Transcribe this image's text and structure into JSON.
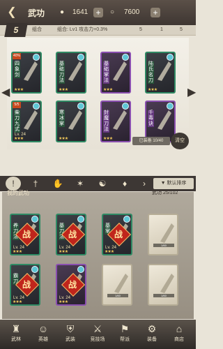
{
  "header": {
    "title": "武功",
    "gold": "1641",
    "silver": "7600",
    "back_icon": "arrow-left-icon",
    "add_label": "+"
  },
  "subbar": {
    "combo_badge": "5",
    "combo_tag": "组合",
    "bonus_text": "组合: Lv1 攻击力+0.3%",
    "stat_a": "5",
    "stat_b": "1",
    "stat_c": "5"
  },
  "equipped": [
    {
      "name": "四象剑",
      "tier": "40%",
      "level": "",
      "stars": "★★★",
      "type": "green"
    },
    {
      "name": "基础刀法",
      "tier": "",
      "level": "",
      "stars": "★★★",
      "type": "green"
    },
    {
      "name": "基础掌法",
      "tier": "",
      "level": "",
      "stars": "★★★",
      "type": "purple"
    },
    {
      "name": "陆氏名刀",
      "tier": "",
      "level": "",
      "stars": "★★★",
      "type": "green"
    },
    {
      "name": "柴刀九式",
      "tier": "5/5",
      "level": "Lv. 24",
      "stars": "★★★",
      "type": "green"
    },
    {
      "name": "寒冰掌",
      "tier": "",
      "level": "",
      "stars": "★★★",
      "type": "green"
    },
    {
      "name": "封魔刀法",
      "tier": "",
      "level": "",
      "stars": "★★★",
      "type": "purple"
    },
    {
      "name": "千毒诀",
      "tier": "",
      "level": "",
      "stars": "★★★",
      "type": "purple"
    }
  ],
  "equip_count": "已装备 10/40",
  "clear_label": "清空",
  "filters": {
    "all": "!",
    "sword": "†",
    "palm": "✋",
    "spider": "✶",
    "taiji": "☯",
    "nav_right": "›",
    "sort_label": "默认排序"
  },
  "owned": {
    "title": "我的武功",
    "count_label": "武功",
    "count": "25/102"
  },
  "owned_cards": [
    {
      "name": "养刀法",
      "type": "green",
      "battle": "战",
      "level": "Lv. 24",
      "stars": "★★★"
    },
    {
      "name": "基刀法",
      "type": "green",
      "battle": "战",
      "level": "Lv. 24",
      "stars": "★★★"
    },
    {
      "name": "基掌",
      "type": "green",
      "battle": "战",
      "level": "Lv. 24",
      "stars": "★★★"
    },
    {
      "name": "",
      "type": "cream",
      "battle": "",
      "level": "",
      "stars": "",
      "progress": "1/60"
    },
    {
      "name": "霸刀",
      "type": "green",
      "battle": "战",
      "level": "Lv. 24",
      "stars": "★★★"
    },
    {
      "name": "",
      "type": "purple",
      "battle": "战",
      "level": "Lv. 24",
      "stars": "★★★"
    },
    {
      "name": "",
      "type": "cream",
      "battle": "",
      "level": "",
      "stars": "",
      "progress": "1/60"
    },
    {
      "name": "",
      "type": "cream",
      "battle": "",
      "level": "",
      "stars": "",
      "progress": "1/60"
    }
  ],
  "bottom_nav": [
    {
      "label": "武林",
      "icon": "tower-icon"
    },
    {
      "label": "英雄",
      "icon": "hero-icon"
    },
    {
      "label": "武装",
      "icon": "armor-icon"
    },
    {
      "label": "竞技场",
      "icon": "arena-icon"
    },
    {
      "label": "帮派",
      "icon": "guild-icon"
    },
    {
      "label": "装备",
      "icon": "gear-icon"
    },
    {
      "label": "商店",
      "icon": "shop-icon"
    }
  ]
}
